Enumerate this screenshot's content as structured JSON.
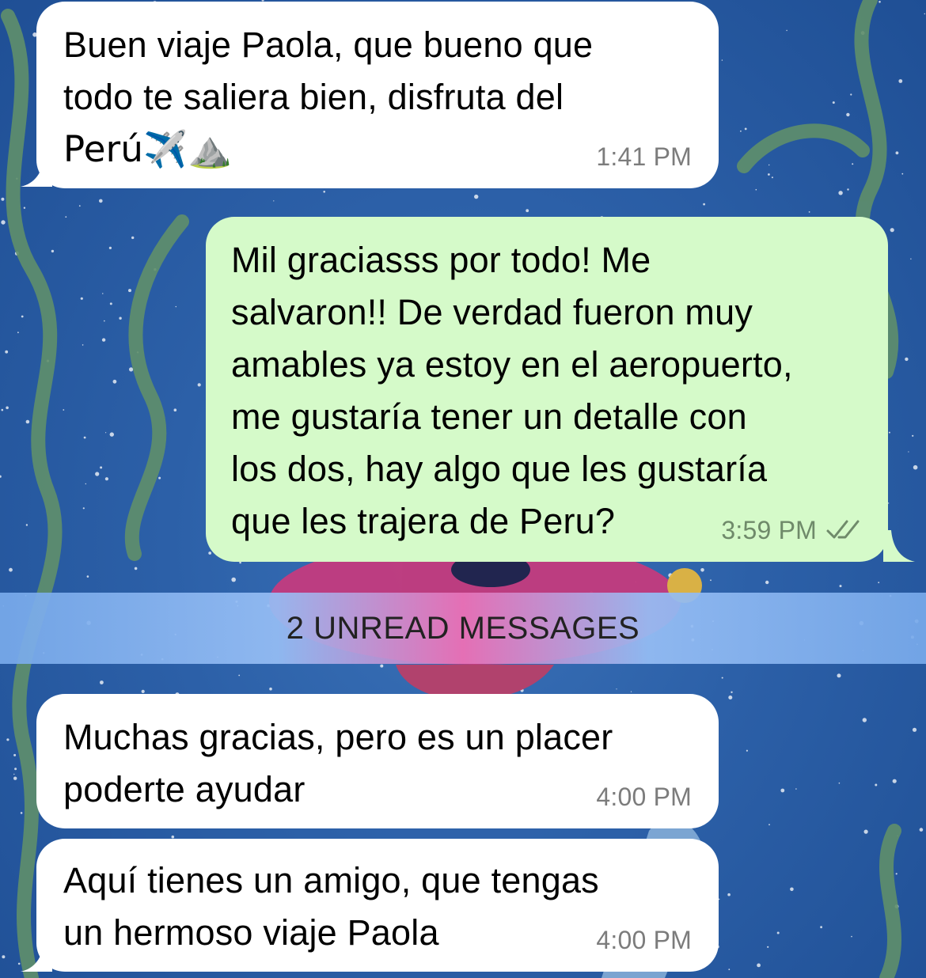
{
  "messages": [
    {
      "direction": "incoming",
      "lines": [
        "Buen viaje Paola, que bueno que",
        "todo te saliera bien, disfruta del",
        "Perú✈️⛰️"
      ],
      "time": "1:41 PM"
    },
    {
      "direction": "outgoing",
      "lines": [
        "Mil graciasss por todo! Me",
        "salvaron!! De verdad fueron muy",
        "amables ya estoy en el aeropuerto,",
        "me gustaría tener un detalle con",
        "los dos, hay algo que les gustaría",
        "que les trajera de Peru?"
      ],
      "time": "3:59 PM",
      "status_icon": "double-check-icon"
    },
    {
      "direction": "incoming",
      "lines": [
        "Muchas gracias, pero es un placer",
        "poderte ayudar"
      ],
      "time": "4:00 PM"
    },
    {
      "direction": "incoming",
      "lines": [
        "Aquí tienes un amigo, que tengas",
        "un hermoso viaje Paola"
      ],
      "time": "4:00 PM"
    }
  ],
  "unread_banner": {
    "label": "2 UNREAD MESSAGES"
  },
  "colors": {
    "incoming_bubble": "#ffffff",
    "outgoing_bubble": "#d5fac9",
    "timestamp": "#7c7c7c",
    "wallpaper": "#2a5fa6"
  }
}
